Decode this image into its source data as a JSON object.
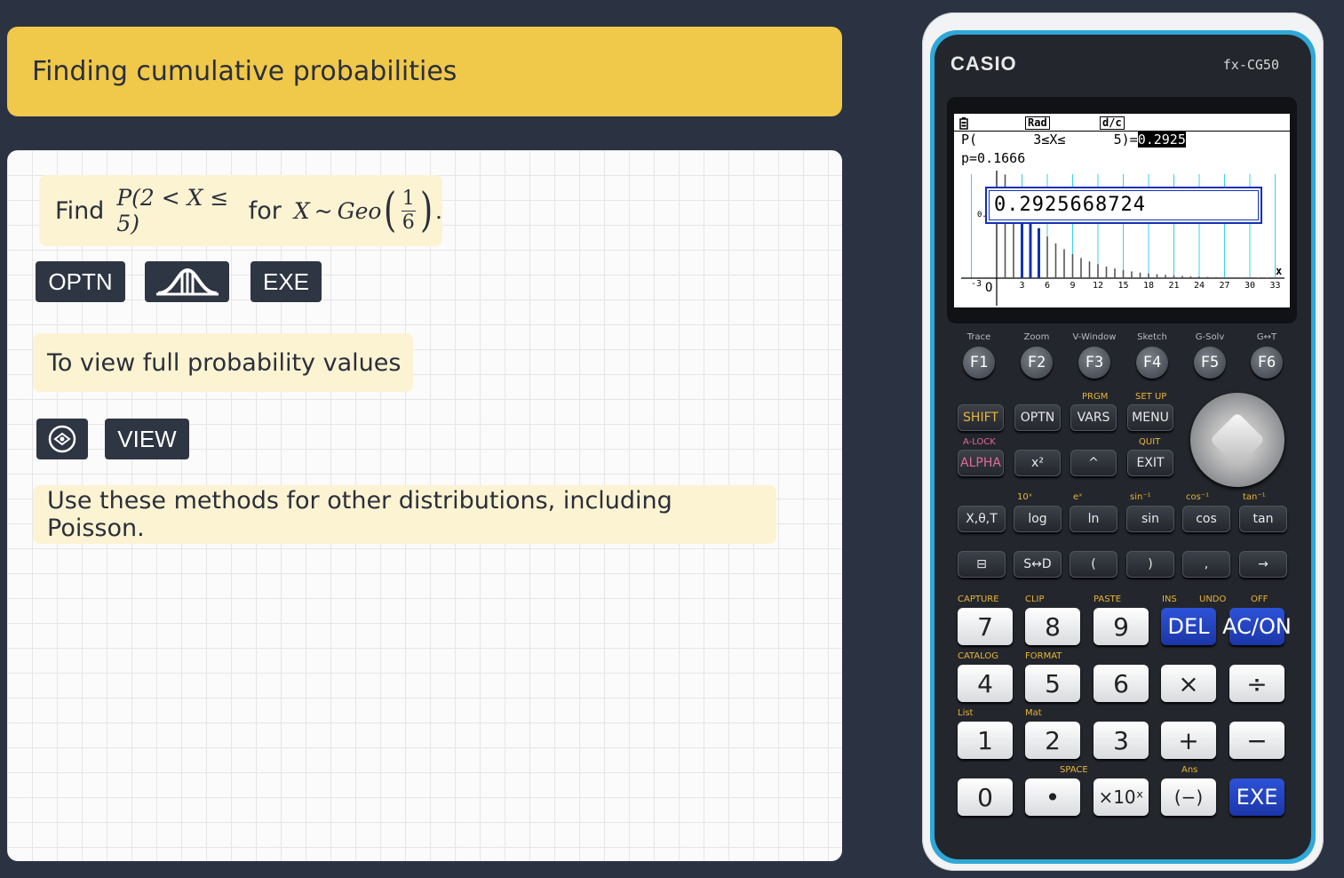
{
  "header": {
    "title": "Finding cumulative probabilities"
  },
  "notes": {
    "find_prefix": "Find",
    "find_prob": "P(2 < X ≤ 5)",
    "find_for": "for",
    "find_dist_var": "X",
    "find_dist_name": "Geo",
    "frac_num": "1",
    "frac_den": "6",
    "find_end": ".",
    "view_text": "To view full probability values",
    "methods_text": "Use these methods for other distributions, including Poisson."
  },
  "keys": {
    "optn": "OPTN",
    "exe": "EXE",
    "view": "VIEW",
    "dist_icon": "distribution-curve-icon",
    "nav_icon": "navigation-pad-icon"
  },
  "calculator": {
    "brand": "CASIO",
    "model": "fx-CG50",
    "status": [
      "Rad",
      "d/c"
    ],
    "line1_prefix": "P(       3≤X≤      5)=",
    "line1_value": "0.2925",
    "line2": "p=0.1666",
    "result_box": "0.2925668724",
    "x_ticks": [
      "3",
      "6",
      "9",
      "12",
      "15",
      "18",
      "21",
      "24",
      "27",
      "30",
      "33"
    ],
    "y_tick": "0.1",
    "neg_tick": "-3",
    "origin": "O",
    "x_axis_label": "x",
    "fn_labels": [
      "Trace",
      "Zoom",
      "V-Window",
      "Sketch",
      "G-Solv",
      "G↔T"
    ],
    "fn_keys": [
      "F1",
      "F2",
      "F3",
      "F4",
      "F5",
      "F6"
    ],
    "row_prgm": "PRGM",
    "row_setup": "SET UP",
    "row_alock": "A-LOCK",
    "row_quit": "QUIT",
    "keys_row1": [
      "SHIFT",
      "OPTN",
      "VARS",
      "MENU"
    ],
    "keys_row2": [
      "ALPHA",
      "x²",
      "^",
      "EXIT"
    ],
    "keys_row3": [
      "X,θ,T",
      "log",
      "ln",
      "sin",
      "cos",
      "tan"
    ],
    "keys_row4": [
      "⊟",
      "S↔D",
      "(",
      ")",
      ",",
      "→"
    ],
    "num_row1": [
      "7",
      "8",
      "9",
      "DEL",
      "AC/ON"
    ],
    "num_row2": [
      "4",
      "5",
      "6",
      "×",
      "÷"
    ],
    "num_row3": [
      "1",
      "2",
      "3",
      "+",
      "−"
    ],
    "num_row4": [
      "0",
      "•",
      "×10ˣ",
      "(−)",
      "EXE"
    ],
    "labels_row1": [
      "CAPTURE",
      "CLIP",
      "PASTE",
      "INS",
      "UNDO",
      "OFF"
    ],
    "labels_row2": [
      "CATALOG",
      "FORMAT"
    ],
    "labels_row3": [
      "List",
      "Mat"
    ],
    "labels_row4": [
      "SPACE",
      "Ans"
    ],
    "trig_labels": [
      "10ˣ",
      "eˣ",
      "sin⁻¹",
      "cos⁻¹",
      "tan⁻¹"
    ]
  }
}
